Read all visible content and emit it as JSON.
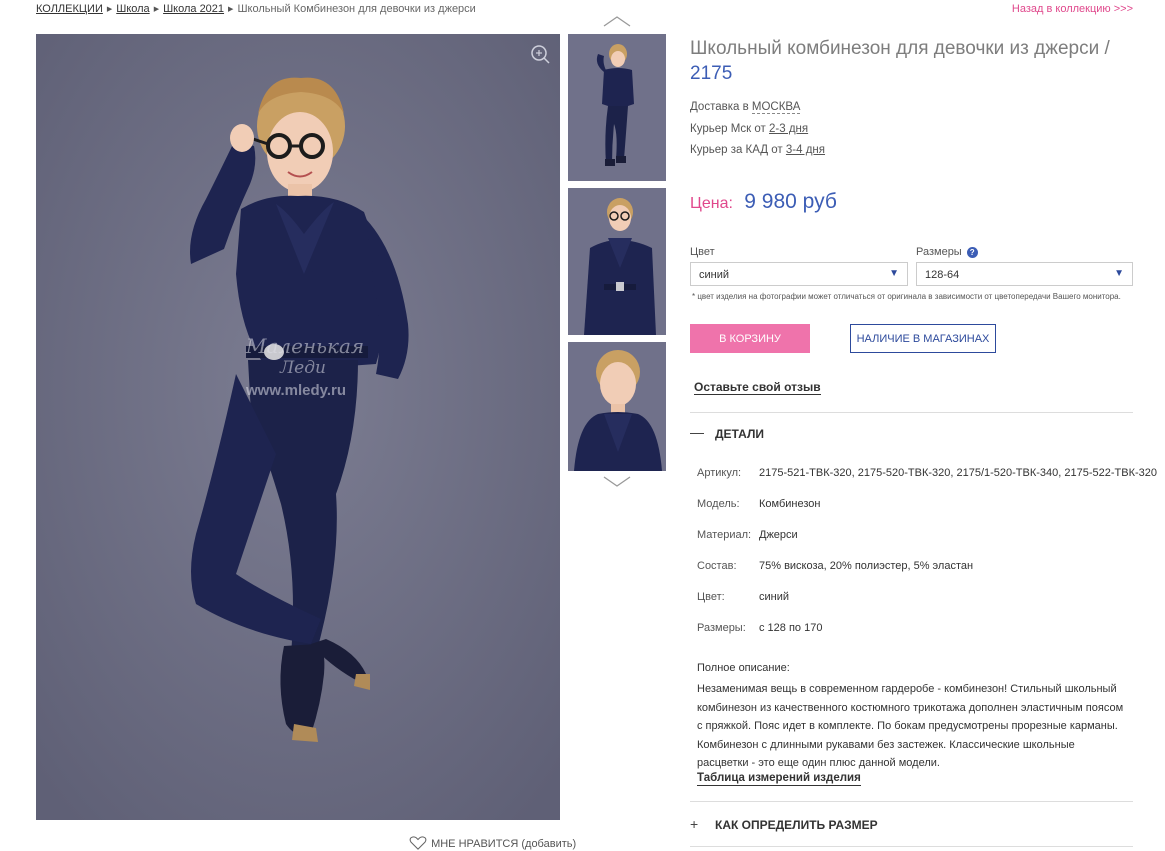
{
  "breadcrumb": {
    "items": [
      "КОЛЛЕКЦИИ",
      "Школа",
      "Школа 2021"
    ],
    "current": "Школьный Комбинезон для девочки из джерси"
  },
  "back_link": "Назад в коллекцию >>>",
  "watermark": {
    "line1": "Маленькая",
    "line2": "Леди",
    "line3": "www.mledy.ru"
  },
  "like": {
    "label": "МНЕ НРАВИТСЯ",
    "action": "(добавить)"
  },
  "product": {
    "title": "Школьный комбинезон для девочки из джерси /",
    "code": "2175"
  },
  "delivery": {
    "line1_prefix": "Доставка в",
    "city": "МОСКВА",
    "line2_prefix": "Курьер Мск от",
    "line2_days": "2-3 дня",
    "line3_prefix": "Курьер за КАД от",
    "line3_days": "3-4 дня"
  },
  "price": {
    "label": "Цена:",
    "value": "9 980 руб"
  },
  "color_field": {
    "label": "Цвет",
    "value": "синий"
  },
  "size_field": {
    "label": "Размеры",
    "value": "128-64"
  },
  "note": "* цвет изделия на фотографии может отличаться от оригинала в зависимости от цветопередачи Вашего монитора.",
  "buttons": {
    "cart": "В КОРЗИНУ",
    "stores": "НАЛИЧИЕ В МАГАЗИНАХ"
  },
  "review_link": "Оставьте свой отзыв",
  "details": {
    "heading": "ДЕТАЛИ",
    "rows": [
      {
        "k": "Артикул:",
        "v": "2175-521-ТВК-320, 2175-520-ТВК-320, 2175/1-520-ТВК-340, 2175-522-ТВК-320"
      },
      {
        "k": "Модель:",
        "v": "Комбинезон"
      },
      {
        "k": "Материал:",
        "v": "Джерси"
      },
      {
        "k": "Состав:",
        "v": "75% вискоза, 20% полиэстер, 5% эластан"
      },
      {
        "k": "Цвет:",
        "v": "синий"
      },
      {
        "k": "Размеры:",
        "v": "с 128 по 170"
      }
    ],
    "desc_label": "Полное описание:",
    "desc": "Незаменимая вещь в современном гардеробе - комбинезон! Стильный школьный комбинезон из качественного костюмного трикотажа дополнен эластичным поясом с пряжкой. Пояс идет в комплекте. По бокам предусмотрены прорезные карманы. Комбинезон с длинными рукавами без застежек. Классические школьные расцветки - это еще один плюс данной модели.",
    "size_table": "Таблица измерений изделия"
  },
  "size_section": {
    "heading": "КАК ОПРЕДЕЛИТЬ РАЗМЕР"
  },
  "colors": {
    "pink": "#ef73ab",
    "blue": "#3c5db5",
    "navy": "#1e2450",
    "bg_photo": "#6e6f84"
  }
}
